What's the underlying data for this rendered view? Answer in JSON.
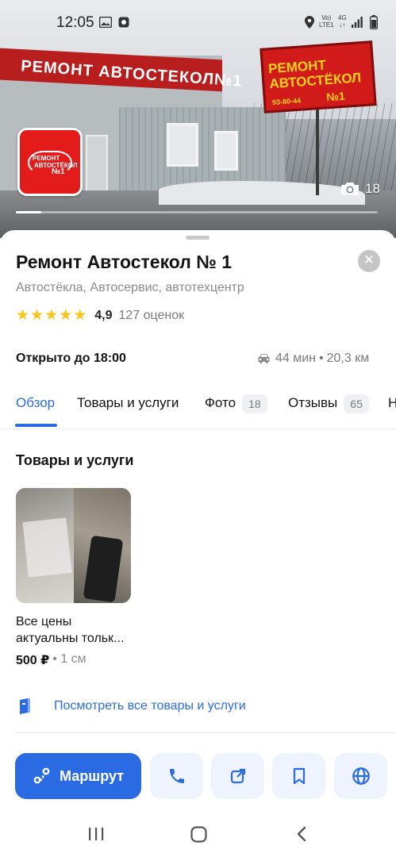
{
  "status_bar": {
    "time": "12:05",
    "network_label_top": "Vo)",
    "network_label_bottom": "LTE1",
    "network_type": "4G",
    "icons": [
      "image-icon",
      "notification-icon",
      "location-icon",
      "signal-icon",
      "battery-icon"
    ]
  },
  "photo": {
    "count": "18",
    "progress": 0.07,
    "building_sign": "РЕМОНТ АВТОСТЕКОЛ№1",
    "billboard_line1": "РЕМОНТ",
    "billboard_line2": "АВТОСТЁКОЛ",
    "billboard_phone": "93-80-44",
    "billboard_number": "№1",
    "logo_line1": "РЕМОНТ",
    "logo_line2": "АВТОСТЁКОЛ",
    "logo_line3": "№1"
  },
  "place": {
    "title": "Ремонт Автостекол № 1",
    "categories": "Автостёкла, Автосервис, автотехцентр",
    "rating": "4,9",
    "rating_count": "127 оценок",
    "stars": 5,
    "hours": "Открыто до 18:00",
    "route_time": "44 мин",
    "route_separator": "•",
    "route_distance": "20,3 км"
  },
  "tabs": [
    {
      "label": "Обзор",
      "badge": ""
    },
    {
      "label": "Товары и услуги",
      "badge": ""
    },
    {
      "label": "Фото",
      "badge": "18"
    },
    {
      "label": "Отзывы",
      "badge": "65"
    },
    {
      "label": "Н",
      "badge": ""
    }
  ],
  "products": {
    "heading": "Товары и услуги",
    "items": [
      {
        "name_line1": "Все цены",
        "name_line2": "актуальны тольк...",
        "price": "500 ₽",
        "unit": "• 1 см"
      }
    ],
    "see_all": "Посмотреть все товары и услуги"
  },
  "actions": {
    "route_label": "Маршрут",
    "buttons": [
      "phone-icon",
      "share-icon",
      "bookmark-icon",
      "globe-icon"
    ]
  },
  "colors": {
    "accent": "#2a6be3",
    "star": "#fcc31a",
    "brand_red": "#e41b1b"
  }
}
